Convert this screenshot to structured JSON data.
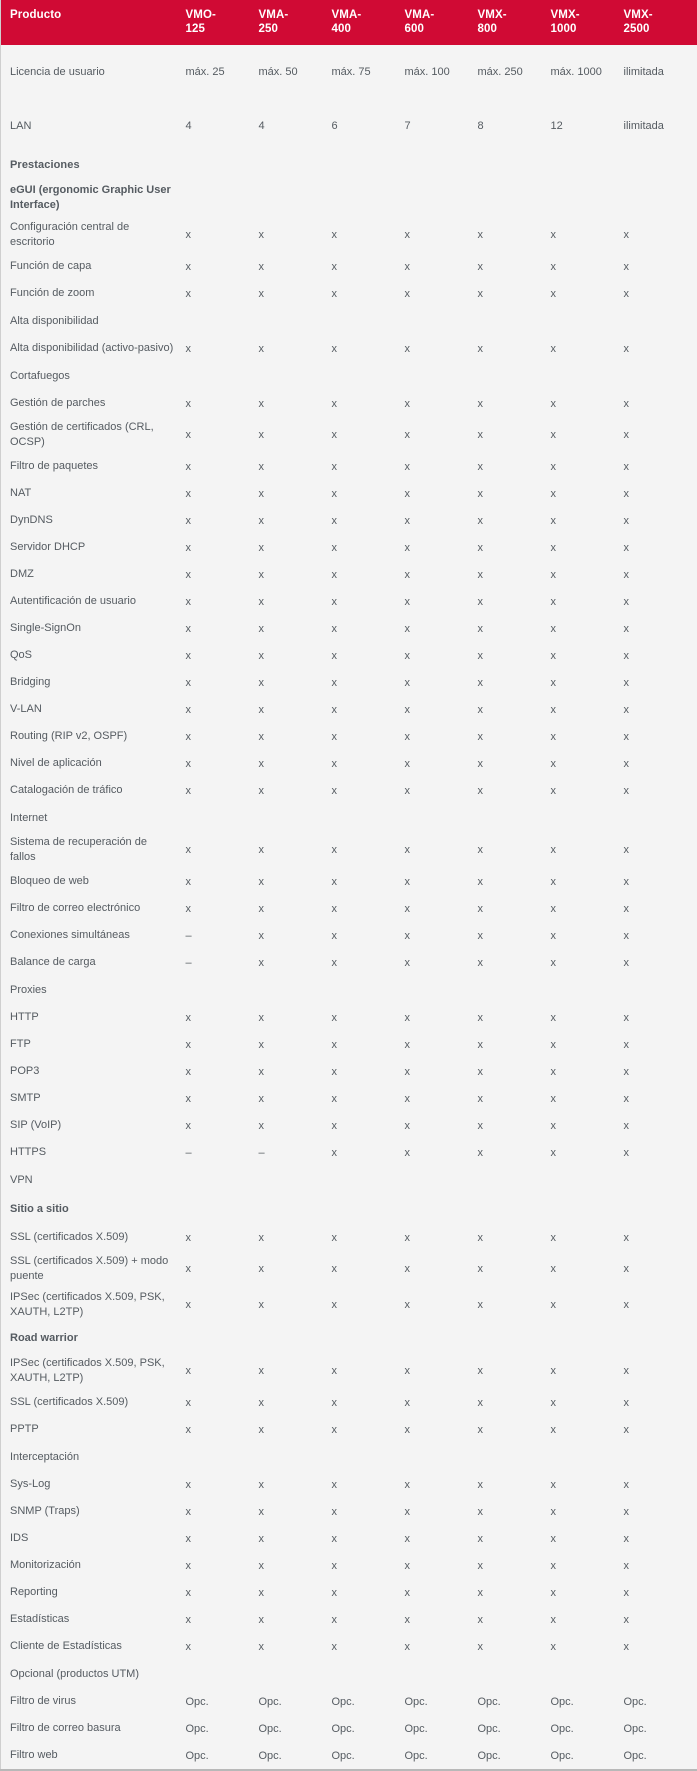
{
  "table": {
    "label_header": "Producto",
    "columns": [
      {
        "line1": "VMO-",
        "line2": "125"
      },
      {
        "line1": "VMA-",
        "line2": "250"
      },
      {
        "line1": "VMA-",
        "line2": "400"
      },
      {
        "line1": "VMA-",
        "line2": "600"
      },
      {
        "line1": "VMX-",
        "line2": "800"
      },
      {
        "line1": "VMX-",
        "line2": "1000"
      },
      {
        "line1": "VMX-",
        "line2": "2500"
      }
    ],
    "accent_color": "#D00A34",
    "body_bg": "#f4f4f4",
    "text_color": "#55595e",
    "section_band": "Prestaciones",
    "top_rows": [
      {
        "label": "Licencia de usuario",
        "values": [
          "máx. 25",
          "máx. 50",
          "máx. 75",
          "máx. 100",
          "máx. 250",
          "máx. 1000",
          "ilimitada"
        ]
      },
      {
        "label": "LAN",
        "values": [
          "4",
          "4",
          "6",
          "7",
          "8",
          "12",
          "ilimitada"
        ]
      }
    ],
    "rows": [
      {
        "type": "group",
        "label": "eGUI (ergonomic Graphic User Interface)",
        "values": [
          "",
          "",
          "",
          "",
          "",
          "",
          ""
        ]
      },
      {
        "type": "feature",
        "label": "Configuración central de escritorio",
        "values": [
          "x",
          "x",
          "x",
          "x",
          "x",
          "x",
          "x"
        ]
      },
      {
        "type": "feature",
        "label": "Función de capa",
        "values": [
          "x",
          "x",
          "x",
          "x",
          "x",
          "x",
          "x"
        ]
      },
      {
        "type": "feature",
        "label": "Función de zoom",
        "values": [
          "x",
          "x",
          "x",
          "x",
          "x",
          "x",
          "x"
        ]
      },
      {
        "type": "caption",
        "label": "Alta disponibilidad",
        "values": [
          "",
          "",
          "",
          "",
          "",
          "",
          ""
        ]
      },
      {
        "type": "feature",
        "label": "Alta disponibilidad (activo-pasivo)",
        "values": [
          "x",
          "x",
          "x",
          "x",
          "x",
          "x",
          "x"
        ]
      },
      {
        "type": "caption",
        "label": "Cortafuegos",
        "values": [
          "",
          "",
          "",
          "",
          "",
          "",
          ""
        ]
      },
      {
        "type": "feature",
        "label": "Gestión de parches",
        "values": [
          "x",
          "x",
          "x",
          "x",
          "x",
          "x",
          "x"
        ]
      },
      {
        "type": "feature",
        "label": "Gestión de certificados (CRL, OCSP)",
        "values": [
          "x",
          "x",
          "x",
          "x",
          "x",
          "x",
          "x"
        ]
      },
      {
        "type": "feature",
        "label": "Filtro de paquetes",
        "values": [
          "x",
          "x",
          "x",
          "x",
          "x",
          "x",
          "x"
        ]
      },
      {
        "type": "feature",
        "label": "NAT",
        "values": [
          "x",
          "x",
          "x",
          "x",
          "x",
          "x",
          "x"
        ]
      },
      {
        "type": "feature",
        "label": "DynDNS",
        "values": [
          "x",
          "x",
          "x",
          "x",
          "x",
          "x",
          "x"
        ]
      },
      {
        "type": "feature",
        "label": "Servidor DHCP",
        "values": [
          "x",
          "x",
          "x",
          "x",
          "x",
          "x",
          "x"
        ]
      },
      {
        "type": "feature",
        "label": "DMZ",
        "values": [
          "x",
          "x",
          "x",
          "x",
          "x",
          "x",
          "x"
        ]
      },
      {
        "type": "feature",
        "label": "Autentificación de usuario",
        "values": [
          "x",
          "x",
          "x",
          "x",
          "x",
          "x",
          "x"
        ]
      },
      {
        "type": "feature",
        "label": "Single-SignOn",
        "values": [
          "x",
          "x",
          "x",
          "x",
          "x",
          "x",
          "x"
        ]
      },
      {
        "type": "feature",
        "label": "QoS",
        "values": [
          "x",
          "x",
          "x",
          "x",
          "x",
          "x",
          "x"
        ]
      },
      {
        "type": "feature",
        "label": "Bridging",
        "values": [
          "x",
          "x",
          "x",
          "x",
          "x",
          "x",
          "x"
        ]
      },
      {
        "type": "feature",
        "label": "V-LAN",
        "values": [
          "x",
          "x",
          "x",
          "x",
          "x",
          "x",
          "x"
        ]
      },
      {
        "type": "feature",
        "label": "Routing (RIP v2, OSPF)",
        "values": [
          "x",
          "x",
          "x",
          "x",
          "x",
          "x",
          "x"
        ]
      },
      {
        "type": "feature",
        "label": "Nivel de aplicación",
        "values": [
          "x",
          "x",
          "x",
          "x",
          "x",
          "x",
          "x"
        ]
      },
      {
        "type": "feature",
        "label": "Catalogación de tráfico",
        "values": [
          "x",
          "x",
          "x",
          "x",
          "x",
          "x",
          "x"
        ]
      },
      {
        "type": "caption",
        "label": "Internet",
        "values": [
          "",
          "",
          "",
          "",
          "",
          "",
          ""
        ]
      },
      {
        "type": "feature",
        "label": "Sistema de recuperación de fallos",
        "values": [
          "x",
          "x",
          "x",
          "x",
          "x",
          "x",
          "x"
        ]
      },
      {
        "type": "feature",
        "label": "Bloqueo de web",
        "values": [
          "x",
          "x",
          "x",
          "x",
          "x",
          "x",
          "x"
        ]
      },
      {
        "type": "feature",
        "label": "Filtro de correo electrónico",
        "values": [
          "x",
          "x",
          "x",
          "x",
          "x",
          "x",
          "x"
        ]
      },
      {
        "type": "feature",
        "label": "Conexiones simultáneas",
        "values": [
          "–",
          "x",
          "x",
          "x",
          "x",
          "x",
          "x"
        ]
      },
      {
        "type": "feature",
        "label": "Balance de carga",
        "values": [
          "–",
          "x",
          "x",
          "x",
          "x",
          "x",
          "x"
        ]
      },
      {
        "type": "caption",
        "label": "Proxies",
        "values": [
          "",
          "",
          "",
          "",
          "",
          "",
          ""
        ]
      },
      {
        "type": "feature",
        "label": "HTTP",
        "values": [
          "x",
          "x",
          "x",
          "x",
          "x",
          "x",
          "x"
        ]
      },
      {
        "type": "feature",
        "label": "FTP",
        "values": [
          "x",
          "x",
          "x",
          "x",
          "x",
          "x",
          "x"
        ]
      },
      {
        "type": "feature",
        "label": "POP3",
        "values": [
          "x",
          "x",
          "x",
          "x",
          "x",
          "x",
          "x"
        ]
      },
      {
        "type": "feature",
        "label": "SMTP",
        "values": [
          "x",
          "x",
          "x",
          "x",
          "x",
          "x",
          "x"
        ]
      },
      {
        "type": "feature",
        "label": "SIP (VoIP)",
        "values": [
          "x",
          "x",
          "x",
          "x",
          "x",
          "x",
          "x"
        ]
      },
      {
        "type": "feature",
        "label": "HTTPS",
        "values": [
          "–",
          "–",
          "x",
          "x",
          "x",
          "x",
          "x"
        ]
      },
      {
        "type": "caption",
        "label": "VPN",
        "values": [
          "",
          "",
          "",
          "",
          "",
          "",
          ""
        ]
      },
      {
        "type": "group",
        "label": "Sitio a sitio",
        "values": [
          "",
          "",
          "",
          "",
          "",
          "",
          ""
        ]
      },
      {
        "type": "feature",
        "label": "SSL (certificados X.509)",
        "values": [
          "x",
          "x",
          "x",
          "x",
          "x",
          "x",
          "x"
        ]
      },
      {
        "type": "feature",
        "label": "SSL (certificados X.509) + modo puente",
        "values": [
          "x",
          "x",
          "x",
          "x",
          "x",
          "x",
          "x"
        ]
      },
      {
        "type": "feature",
        "label": "IPSec (certificados X.509, PSK, XAUTH, L2TP)",
        "values": [
          "x",
          "x",
          "x",
          "x",
          "x",
          "x",
          "x"
        ]
      },
      {
        "type": "group",
        "label": "Road warrior",
        "values": [
          "",
          "",
          "",
          "",
          "",
          "",
          ""
        ]
      },
      {
        "type": "feature",
        "label": "IPSec (certificados X.509, PSK, XAUTH, L2TP)",
        "values": [
          "x",
          "x",
          "x",
          "x",
          "x",
          "x",
          "x"
        ]
      },
      {
        "type": "feature",
        "label": "SSL (certificados X.509)",
        "values": [
          "x",
          "x",
          "x",
          "x",
          "x",
          "x",
          "x"
        ]
      },
      {
        "type": "feature",
        "label": "PPTP",
        "values": [
          "x",
          "x",
          "x",
          "x",
          "x",
          "x",
          "x"
        ]
      },
      {
        "type": "caption",
        "label": "Interceptación",
        "values": [
          "",
          "",
          "",
          "",
          "",
          "",
          ""
        ]
      },
      {
        "type": "feature",
        "label": "Sys-Log",
        "values": [
          "x",
          "x",
          "x",
          "x",
          "x",
          "x",
          "x"
        ]
      },
      {
        "type": "feature",
        "label": "SNMP (Traps)",
        "values": [
          "x",
          "x",
          "x",
          "x",
          "x",
          "x",
          "x"
        ]
      },
      {
        "type": "feature",
        "label": "IDS",
        "values": [
          "x",
          "x",
          "x",
          "x",
          "x",
          "x",
          "x"
        ]
      },
      {
        "type": "feature",
        "label": "Monitorización",
        "values": [
          "x",
          "x",
          "x",
          "x",
          "x",
          "x",
          "x"
        ]
      },
      {
        "type": "feature",
        "label": "Reporting",
        "values": [
          "x",
          "x",
          "x",
          "x",
          "x",
          "x",
          "x"
        ]
      },
      {
        "type": "feature",
        "label": "Estadísticas",
        "values": [
          "x",
          "x",
          "x",
          "x",
          "x",
          "x",
          "x"
        ]
      },
      {
        "type": "feature",
        "label": "Cliente de Estadísticas",
        "values": [
          "x",
          "x",
          "x",
          "x",
          "x",
          "x",
          "x"
        ]
      },
      {
        "type": "caption",
        "label": "Opcional (productos UTM)",
        "values": [
          "",
          "",
          "",
          "",
          "",
          "",
          ""
        ]
      },
      {
        "type": "feature",
        "label": "Filtro de virus",
        "values": [
          "Opc.",
          "Opc.",
          "Opc.",
          "Opc.",
          "Opc.",
          "Opc.",
          "Opc."
        ]
      },
      {
        "type": "feature",
        "label": "Filtro de correo basura",
        "values": [
          "Opc.",
          "Opc.",
          "Opc.",
          "Opc.",
          "Opc.",
          "Opc.",
          "Opc."
        ]
      },
      {
        "type": "feature",
        "label": "Filtro web",
        "values": [
          "Opc.",
          "Opc.",
          "Opc.",
          "Opc.",
          "Opc.",
          "Opc.",
          "Opc."
        ]
      }
    ]
  }
}
